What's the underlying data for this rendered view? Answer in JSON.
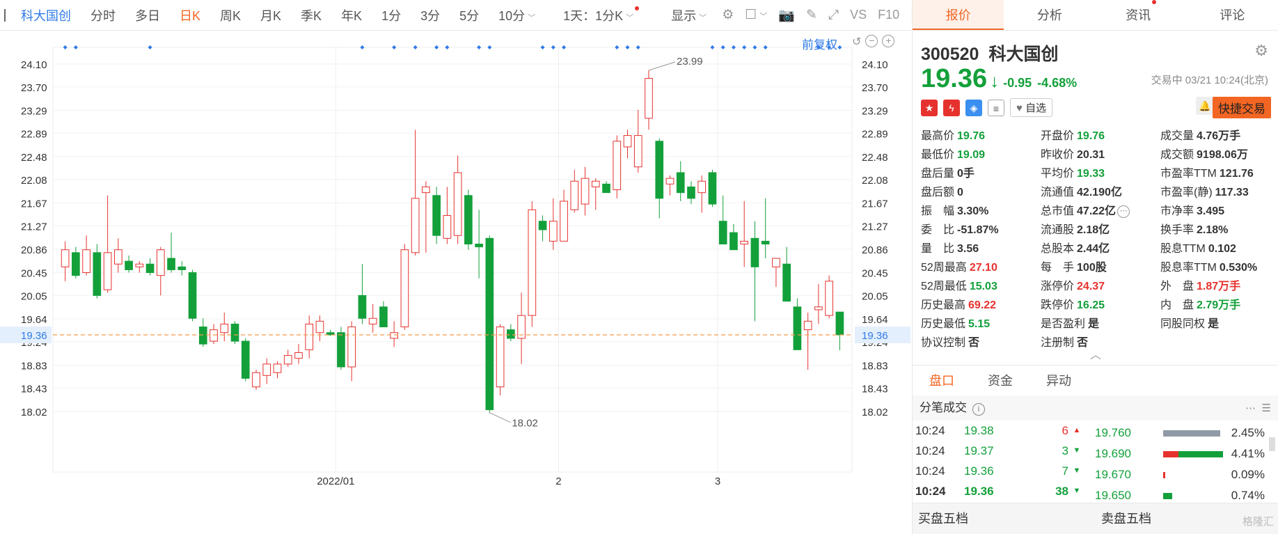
{
  "toolbar": {
    "stock_name": "科大国创",
    "periods": [
      "分时",
      "多日",
      "日K",
      "周K",
      "月K",
      "季K",
      "年K",
      "1分",
      "3分",
      "5分",
      "10分"
    ],
    "active_period": "日K",
    "multi_day_label": "1天：1分K",
    "display_label": "显示",
    "fuquan_label": "前复权"
  },
  "chart_data": {
    "type": "candlestick",
    "y_ticks": [
      "24.10",
      "23.70",
      "23.29",
      "22.89",
      "22.48",
      "22.08",
      "21.67",
      "21.27",
      "20.86",
      "20.45",
      "20.05",
      "19.64",
      "19.24",
      "18.83",
      "18.43",
      "18.02"
    ],
    "ylim": [
      17.7,
      24.5
    ],
    "x_labels": [
      "2022/01",
      "2",
      "3"
    ],
    "current_price": "19.36",
    "max_label": "23.99",
    "min_label": "18.02",
    "candles": [
      {
        "o": 20.55,
        "h": 21.0,
        "l": 20.3,
        "c": 20.85
      },
      {
        "o": 20.8,
        "h": 20.9,
        "l": 20.35,
        "c": 20.4
      },
      {
        "o": 20.45,
        "h": 21.1,
        "l": 20.4,
        "c": 20.85
      },
      {
        "o": 20.8,
        "h": 20.95,
        "l": 20.0,
        "c": 20.05
      },
      {
        "o": 20.15,
        "h": 21.8,
        "l": 20.1,
        "c": 20.8
      },
      {
        "o": 20.6,
        "h": 21.05,
        "l": 20.45,
        "c": 20.85
      },
      {
        "o": 20.65,
        "h": 20.75,
        "l": 20.45,
        "c": 20.5
      },
      {
        "o": 20.55,
        "h": 20.65,
        "l": 20.45,
        "c": 20.6
      },
      {
        "o": 20.6,
        "h": 20.7,
        "l": 20.4,
        "c": 20.45
      },
      {
        "o": 20.4,
        "h": 20.9,
        "l": 20.05,
        "c": 20.85
      },
      {
        "o": 20.7,
        "h": 21.15,
        "l": 20.45,
        "c": 20.5
      },
      {
        "o": 20.55,
        "h": 20.65,
        "l": 20.4,
        "c": 20.5
      },
      {
        "o": 20.45,
        "h": 20.5,
        "l": 19.6,
        "c": 19.65
      },
      {
        "o": 19.5,
        "h": 19.65,
        "l": 19.15,
        "c": 19.2
      },
      {
        "o": 19.25,
        "h": 19.55,
        "l": 19.2,
        "c": 19.45
      },
      {
        "o": 19.4,
        "h": 19.75,
        "l": 19.25,
        "c": 19.55
      },
      {
        "o": 19.55,
        "h": 19.6,
        "l": 19.2,
        "c": 19.25
      },
      {
        "o": 19.25,
        "h": 19.3,
        "l": 18.55,
        "c": 18.6
      },
      {
        "o": 18.45,
        "h": 18.75,
        "l": 18.4,
        "c": 18.7
      },
      {
        "o": 18.65,
        "h": 18.95,
        "l": 18.5,
        "c": 18.85
      },
      {
        "o": 18.7,
        "h": 18.9,
        "l": 18.6,
        "c": 18.85
      },
      {
        "o": 18.85,
        "h": 19.1,
        "l": 18.8,
        "c": 19.0
      },
      {
        "o": 18.95,
        "h": 19.2,
        "l": 18.85,
        "c": 19.05
      },
      {
        "o": 19.1,
        "h": 19.7,
        "l": 18.95,
        "c": 19.55
      },
      {
        "o": 19.4,
        "h": 19.7,
        "l": 19.25,
        "c": 19.6
      },
      {
        "o": 19.4,
        "h": 19.45,
        "l": 19.35,
        "c": 19.36
      },
      {
        "o": 19.4,
        "h": 19.5,
        "l": 18.75,
        "c": 18.8
      },
      {
        "o": 18.8,
        "h": 19.6,
        "l": 18.55,
        "c": 19.5
      },
      {
        "o": 20.05,
        "h": 20.6,
        "l": 19.55,
        "c": 19.65
      },
      {
        "o": 19.55,
        "h": 19.9,
        "l": 19.4,
        "c": 19.65
      },
      {
        "o": 19.85,
        "h": 19.95,
        "l": 19.5,
        "c": 19.5
      },
      {
        "o": 19.3,
        "h": 19.6,
        "l": 19.15,
        "c": 19.4
      },
      {
        "o": 19.5,
        "h": 20.95,
        "l": 19.45,
        "c": 20.85
      },
      {
        "o": 20.8,
        "h": 22.95,
        "l": 20.75,
        "c": 21.75
      },
      {
        "o": 21.85,
        "h": 22.05,
        "l": 20.8,
        "c": 21.95
      },
      {
        "o": 21.8,
        "h": 21.95,
        "l": 20.95,
        "c": 21.1
      },
      {
        "o": 21.05,
        "h": 21.95,
        "l": 20.95,
        "c": 21.45
      },
      {
        "o": 21.1,
        "h": 22.5,
        "l": 20.95,
        "c": 22.2
      },
      {
        "o": 21.8,
        "h": 21.9,
        "l": 20.85,
        "c": 20.95
      },
      {
        "o": 20.95,
        "h": 21.55,
        "l": 20.35,
        "c": 20.9
      },
      {
        "o": 21.05,
        "h": 21.1,
        "l": 18.0,
        "c": 18.05
      },
      {
        "o": 18.45,
        "h": 19.55,
        "l": 18.3,
        "c": 19.5
      },
      {
        "o": 19.45,
        "h": 19.55,
        "l": 19.25,
        "c": 19.3
      },
      {
        "o": 19.3,
        "h": 20.1,
        "l": 18.85,
        "c": 19.7
      },
      {
        "o": 19.7,
        "h": 21.7,
        "l": 19.5,
        "c": 21.55
      },
      {
        "o": 21.35,
        "h": 21.45,
        "l": 21.0,
        "c": 21.2
      },
      {
        "o": 21.0,
        "h": 21.75,
        "l": 20.85,
        "c": 21.35
      },
      {
        "o": 21.0,
        "h": 21.9,
        "l": 21.0,
        "c": 21.7
      },
      {
        "o": 21.55,
        "h": 22.25,
        "l": 21.5,
        "c": 22.05
      },
      {
        "o": 21.65,
        "h": 22.3,
        "l": 21.45,
        "c": 22.1
      },
      {
        "o": 21.95,
        "h": 22.1,
        "l": 21.55,
        "c": 22.05
      },
      {
        "o": 22.0,
        "h": 22.05,
        "l": 21.85,
        "c": 21.85
      },
      {
        "o": 21.9,
        "h": 22.85,
        "l": 21.75,
        "c": 22.75
      },
      {
        "o": 22.65,
        "h": 22.95,
        "l": 22.45,
        "c": 22.85
      },
      {
        "o": 22.3,
        "h": 23.3,
        "l": 22.2,
        "c": 22.85
      },
      {
        "o": 23.15,
        "h": 23.99,
        "l": 22.95,
        "c": 23.85
      },
      {
        "o": 22.75,
        "h": 22.8,
        "l": 21.4,
        "c": 21.75
      },
      {
        "o": 22.0,
        "h": 22.15,
        "l": 21.8,
        "c": 22.1
      },
      {
        "o": 22.2,
        "h": 22.4,
        "l": 21.7,
        "c": 21.85
      },
      {
        "o": 21.95,
        "h": 22.05,
        "l": 21.65,
        "c": 21.75
      },
      {
        "o": 21.85,
        "h": 22.15,
        "l": 21.5,
        "c": 22.05
      },
      {
        "o": 22.2,
        "h": 22.25,
        "l": 21.6,
        "c": 21.65
      },
      {
        "o": 21.35,
        "h": 21.8,
        "l": 20.95,
        "c": 20.95
      },
      {
        "o": 21.15,
        "h": 21.3,
        "l": 20.85,
        "c": 20.85
      },
      {
        "o": 20.95,
        "h": 21.7,
        "l": 20.55,
        "c": 21.0
      },
      {
        "o": 21.05,
        "h": 21.35,
        "l": 19.6,
        "c": 20.55
      },
      {
        "o": 21.0,
        "h": 21.75,
        "l": 20.7,
        "c": 20.95
      },
      {
        "o": 20.55,
        "h": 20.7,
        "l": 20.2,
        "c": 20.7
      },
      {
        "o": 20.6,
        "h": 20.9,
        "l": 19.95,
        "c": 19.95
      },
      {
        "o": 19.85,
        "h": 20.0,
        "l": 19.1,
        "c": 19.1
      },
      {
        "o": 19.45,
        "h": 19.75,
        "l": 18.75,
        "c": 19.6
      },
      {
        "o": 19.8,
        "h": 20.25,
        "l": 19.55,
        "c": 19.85
      },
      {
        "o": 19.7,
        "h": 20.4,
        "l": 19.65,
        "c": 20.3
      },
      {
        "o": 19.76,
        "h": 19.76,
        "l": 19.09,
        "c": 19.36
      }
    ]
  },
  "panel": {
    "tabs": [
      "报价",
      "分析",
      "资讯",
      "评论"
    ],
    "code": "300520",
    "name": "科大国创",
    "last_price": "19.36",
    "change": "-0.95",
    "change_pct": "-4.68%",
    "status": "交易中 03/21 10:24(北京)",
    "watch_label": "自选",
    "quick_trade": "快捷交易",
    "stats": [
      {
        "l": "最高价",
        "v": "19.76",
        "c": "dn"
      },
      {
        "l": "开盘价",
        "v": "19.76",
        "c": "dn"
      },
      {
        "l": "成交量",
        "v": "4.76万手",
        "c": "nt"
      },
      {
        "l": "最低价",
        "v": "19.09",
        "c": "dn"
      },
      {
        "l": "昨收价",
        "v": "20.31",
        "c": "nt"
      },
      {
        "l": "成交额",
        "v": "9198.06万",
        "c": "nt"
      },
      {
        "l": "盘后量",
        "v": "0手",
        "c": "nt"
      },
      {
        "l": "平均价",
        "v": "19.33",
        "c": "dn"
      },
      {
        "l": "市盈率TTM",
        "v": "121.76",
        "c": "nt"
      },
      {
        "l": "盘后额",
        "v": "0",
        "c": "nt"
      },
      {
        "l": "流通值",
        "v": "42.190亿",
        "c": "nt"
      },
      {
        "l": "市盈率(静)",
        "v": "117.33",
        "c": "nt"
      },
      {
        "l": "振　幅",
        "v": "3.30%",
        "c": "nt"
      },
      {
        "l": "总市值",
        "v": "47.22亿",
        "c": "nt"
      },
      {
        "l": "市净率",
        "v": "3.495",
        "c": "nt"
      },
      {
        "l": "委　比",
        "v": "-51.87%",
        "c": "nt"
      },
      {
        "l": "流通股",
        "v": "2.18亿",
        "c": "nt"
      },
      {
        "l": "换手率",
        "v": "2.18%",
        "c": "nt"
      },
      {
        "l": "量　比",
        "v": "3.56",
        "c": "nt"
      },
      {
        "l": "总股本",
        "v": "2.44亿",
        "c": "nt"
      },
      {
        "l": "股息TTM",
        "v": "0.102",
        "c": "nt"
      },
      {
        "l": "52周最高",
        "v": "27.10",
        "c": "up"
      },
      {
        "l": "每　手",
        "v": "100股",
        "c": "nt"
      },
      {
        "l": "股息率TTM",
        "v": "0.530%",
        "c": "nt"
      },
      {
        "l": "52周最低",
        "v": "15.03",
        "c": "dn"
      },
      {
        "l": "涨停价",
        "v": "24.37",
        "c": "up"
      },
      {
        "l": "外　盘",
        "v": "1.87万手",
        "c": "up"
      },
      {
        "l": "历史最高",
        "v": "69.22",
        "c": "up"
      },
      {
        "l": "跌停价",
        "v": "16.25",
        "c": "dn"
      },
      {
        "l": "内　盘",
        "v": "2.79万手",
        "c": "dn"
      },
      {
        "l": "历史最低",
        "v": "5.15",
        "c": "dn"
      },
      {
        "l": "是否盈利",
        "v": "是",
        "c": "nt"
      },
      {
        "l": "同股同权",
        "v": "是",
        "c": "nt"
      },
      {
        "l": "协议控制",
        "v": "否",
        "c": "nt"
      },
      {
        "l": "注册制",
        "v": "否",
        "c": "nt"
      },
      {
        "l": "",
        "v": "",
        "c": "nt"
      }
    ],
    "subtabs": [
      "盘口",
      "资金",
      "异动"
    ],
    "ticks_title": "分笔成交",
    "ticks": [
      {
        "t": "10:24",
        "p": "19.38",
        "v": "6",
        "d": "up"
      },
      {
        "t": "10:24",
        "p": "19.37",
        "v": "3",
        "d": "dn"
      },
      {
        "t": "10:24",
        "p": "19.36",
        "v": "7",
        "d": "dn"
      },
      {
        "t": "10:24",
        "p": "19.36",
        "v": "38",
        "d": "dn"
      }
    ],
    "dist": [
      {
        "p": "19.760",
        "pct": "2.45%",
        "grey": 0.95,
        "red": 0,
        "green": 0
      },
      {
        "p": "19.690",
        "pct": "4.41%",
        "grey": 0,
        "red": 0.25,
        "green": 0.75
      },
      {
        "p": "19.670",
        "pct": "0.09%",
        "grey": 0,
        "red": 0.03,
        "green": 0
      },
      {
        "p": "19.650",
        "pct": "0.74%",
        "grey": 0,
        "red": 0,
        "green": 0.15
      }
    ],
    "buy5": "买盘五档",
    "sell5": "卖盘五档",
    "watermark": "格隆汇"
  }
}
